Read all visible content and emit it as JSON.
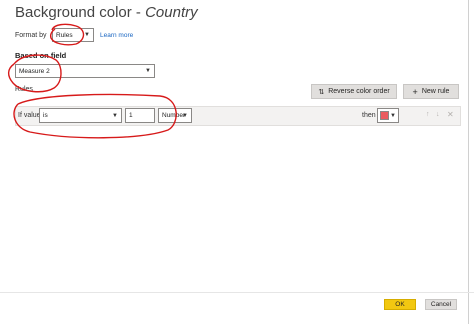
{
  "title": {
    "main": "Background color - ",
    "italic": "Country"
  },
  "format_by": {
    "label": "Format by",
    "value": "Rules",
    "learn_more": "Learn more"
  },
  "based_on": {
    "heading": "Based on field",
    "value": "Measure 2"
  },
  "rules": {
    "label": "Rules",
    "reverse_label": "Reverse color order",
    "new_rule_label": "New rule",
    "if_value_label": "If value",
    "operator": "is",
    "value": "1",
    "type": "Number",
    "then_label": "then",
    "color": "#ea5b5f"
  },
  "footer": {
    "ok_label": "OK",
    "cancel_label": "Cancel"
  },
  "colors": {
    "accent": "#f2c811",
    "annotation": "#d71a1a"
  }
}
